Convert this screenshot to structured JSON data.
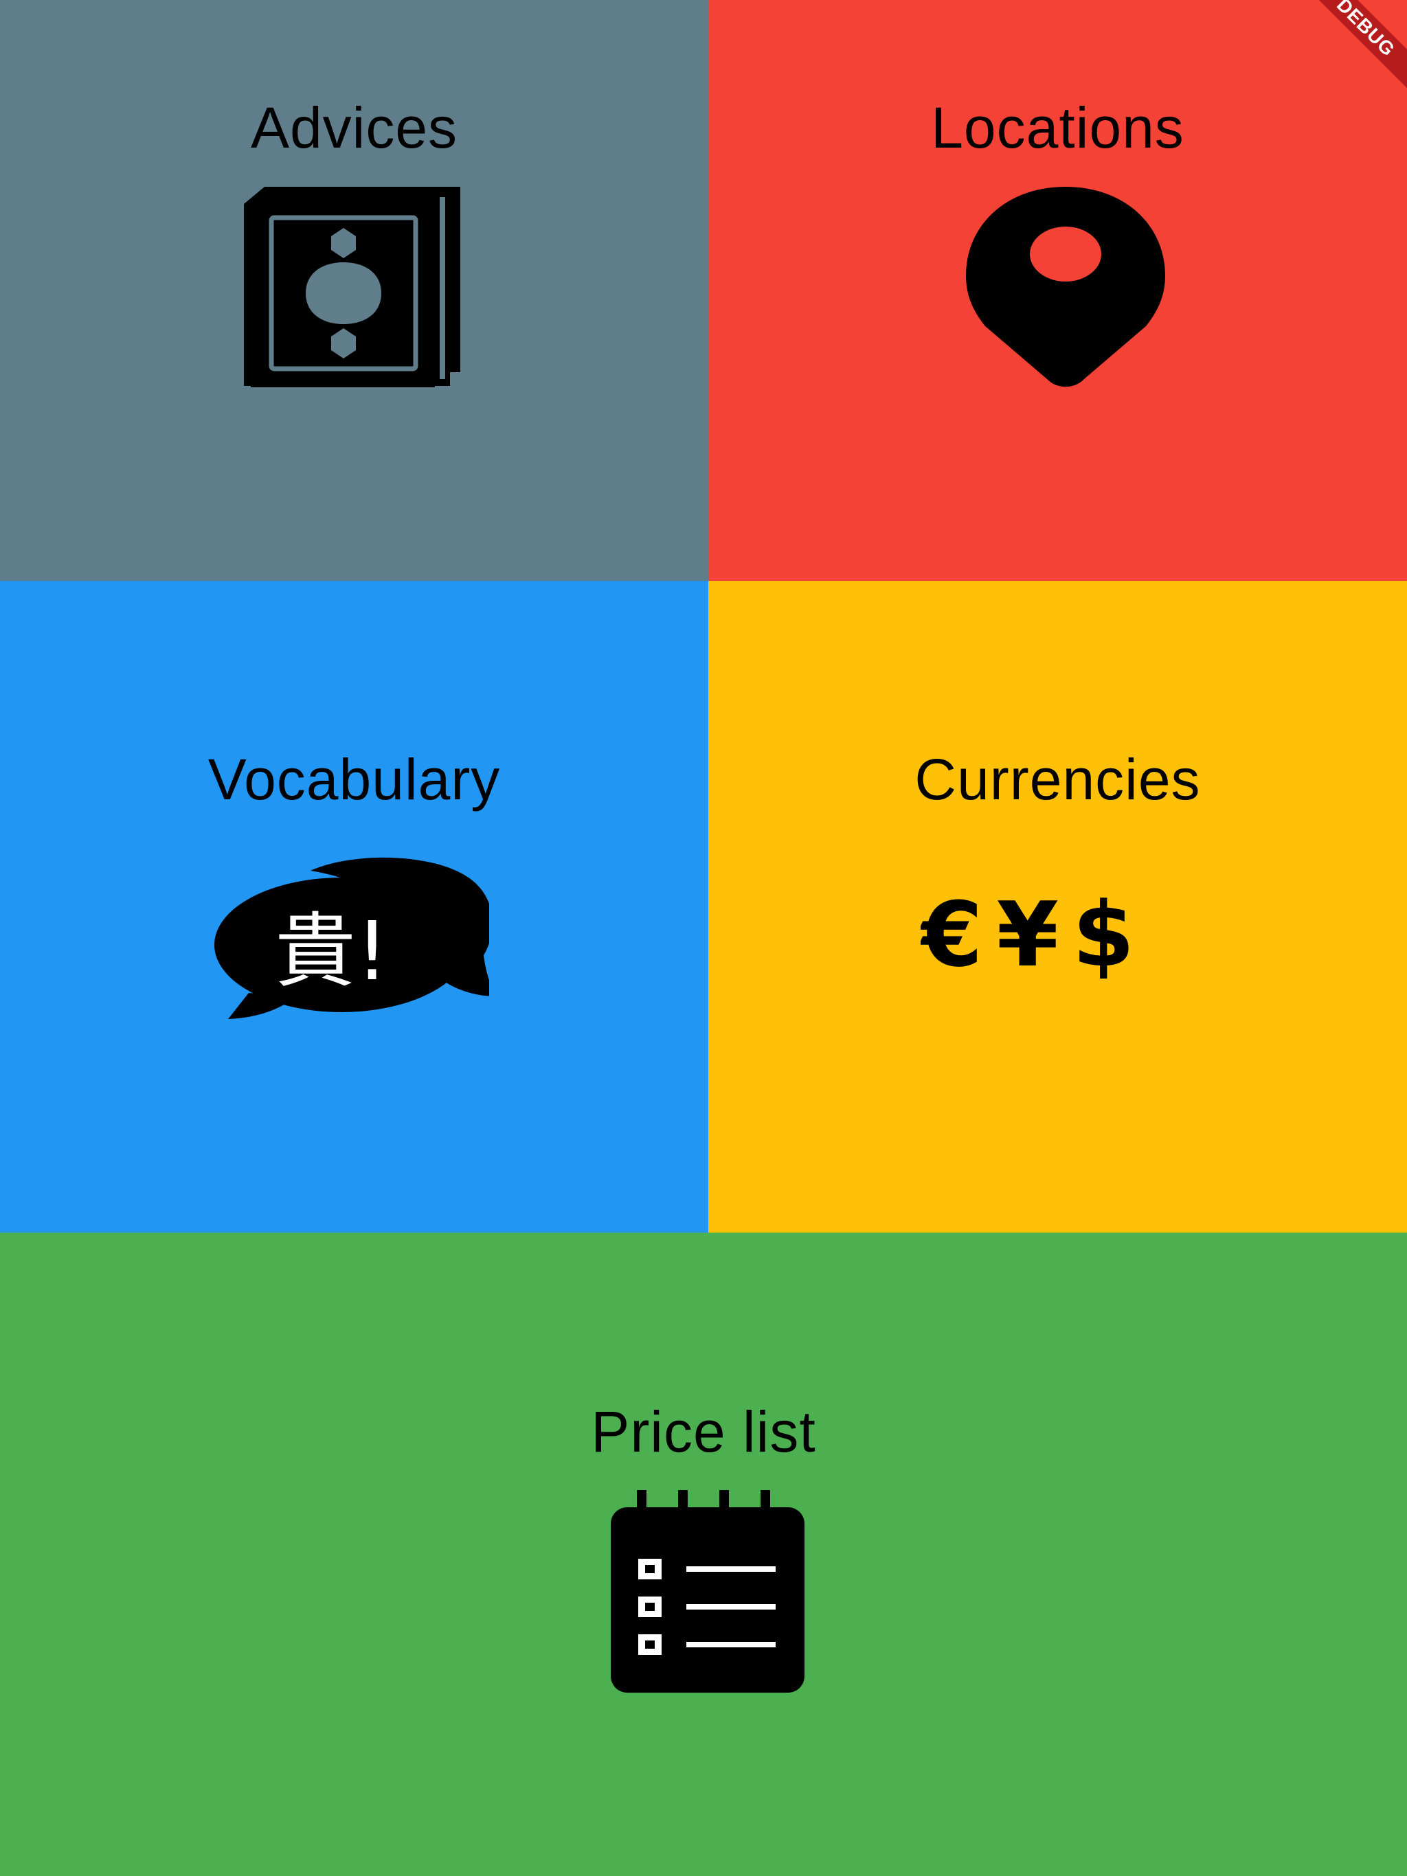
{
  "tiles": [
    {
      "id": "advices",
      "label": "Advices",
      "icon": "book-icon",
      "color": "#607D8B"
    },
    {
      "id": "locations",
      "label": "Locations",
      "icon": "map-pin-icon",
      "color": "#F44336"
    },
    {
      "id": "vocabulary",
      "label": "Vocabulary",
      "icon": "speech-bubbles-icon",
      "icon_text": "貴!",
      "color": "#2196F3"
    },
    {
      "id": "currencies",
      "label": "Currencies",
      "icon": "currency-symbols-icon",
      "icon_text": "€¥$",
      "color": "#FFC107"
    },
    {
      "id": "price_list",
      "label": "Price list",
      "icon": "notepad-checklist-icon",
      "color": "#4CAF50"
    }
  ],
  "debug_banner": {
    "label": "DEBUG",
    "color": "#B71C1C"
  }
}
